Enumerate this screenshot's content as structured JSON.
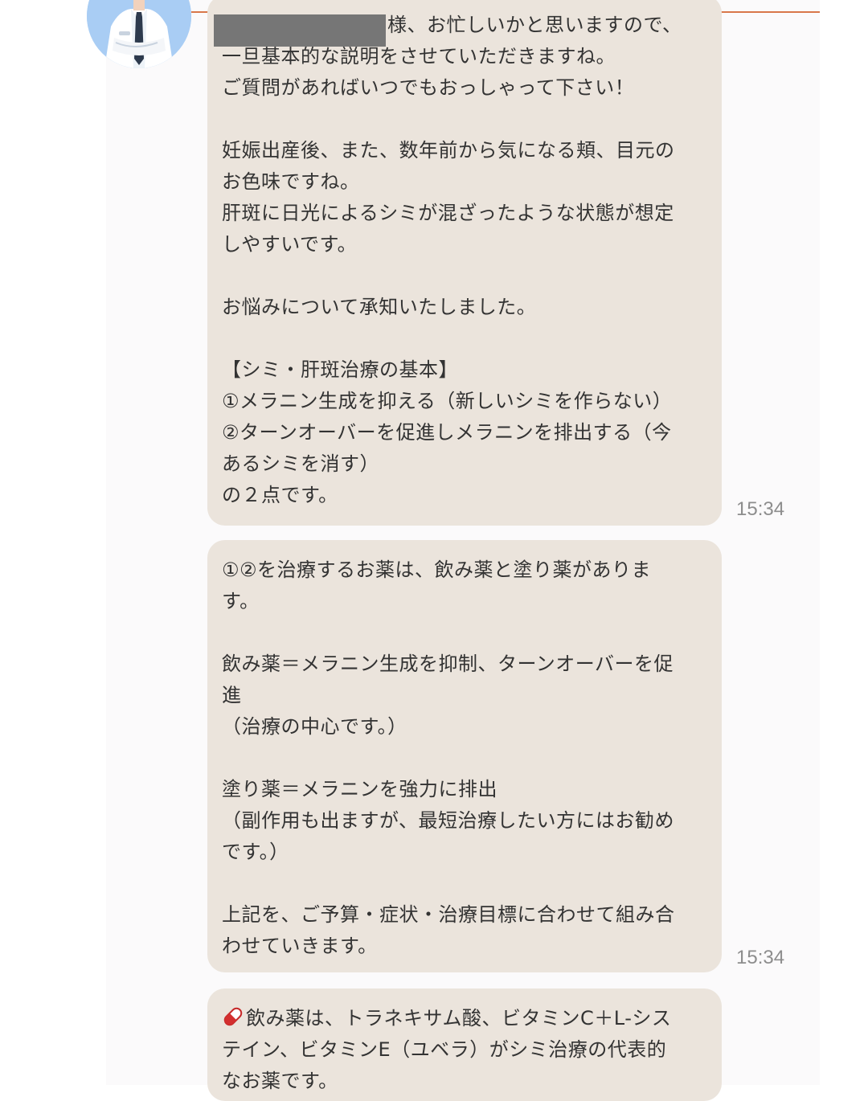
{
  "messages": [
    {
      "lines": [
        "様、お忙しいかと思いますので、",
        "一旦基本的な説明をさせていただきますね。",
        "ご質問があればいつでもおっしゃって下さい！",
        "",
        "妊娠出産後、また、数年前から気になる頬、目元の",
        "お色味ですね。",
        "肝斑に日光によるシミが混ざったような状態が想定",
        "しやすいです。",
        "",
        "お悩みについて承知いたしました。",
        "",
        "【シミ・肝斑治療の基本】",
        "①メラニン生成を抑える（新しいシミを作らない）",
        "②ターンオーバーを促進しメラニンを排出する（今",
        "あるシミを消す）",
        "の２点です。"
      ],
      "time": "15:34"
    },
    {
      "lines": [
        "①②を治療するお薬は、飲み薬と塗り薬がありま",
        "す。",
        "",
        "飲み薬＝メラニン生成を抑制、ターンオーバーを促",
        "進",
        "（治療の中心です。）",
        "",
        "塗り薬＝メラニンを強力に排出",
        "（副作用も出ますが、最短治療したい方にはお勧め",
        "です。）",
        "",
        "上記を、ご予算・症状・治療目標に合わせて組み合",
        "わせていきます。"
      ],
      "time": "15:34"
    },
    {
      "lines": [
        "飲み薬は、トラネキサム酸、ビタミンC＋L-シス",
        "テイン、ビタミンE（ユベラ）がシミ治療の代表的",
        "なお薬です。"
      ],
      "icon": "pill-icon"
    }
  ],
  "colors": {
    "bubble": "#ebe4dc",
    "accent_line": "#d9774a",
    "avatar_bg": "#a9cdf4",
    "redaction": "#767676",
    "timestamp": "#8d8d8d"
  },
  "icons": [
    "doctor-avatar",
    "pill-icon"
  ]
}
